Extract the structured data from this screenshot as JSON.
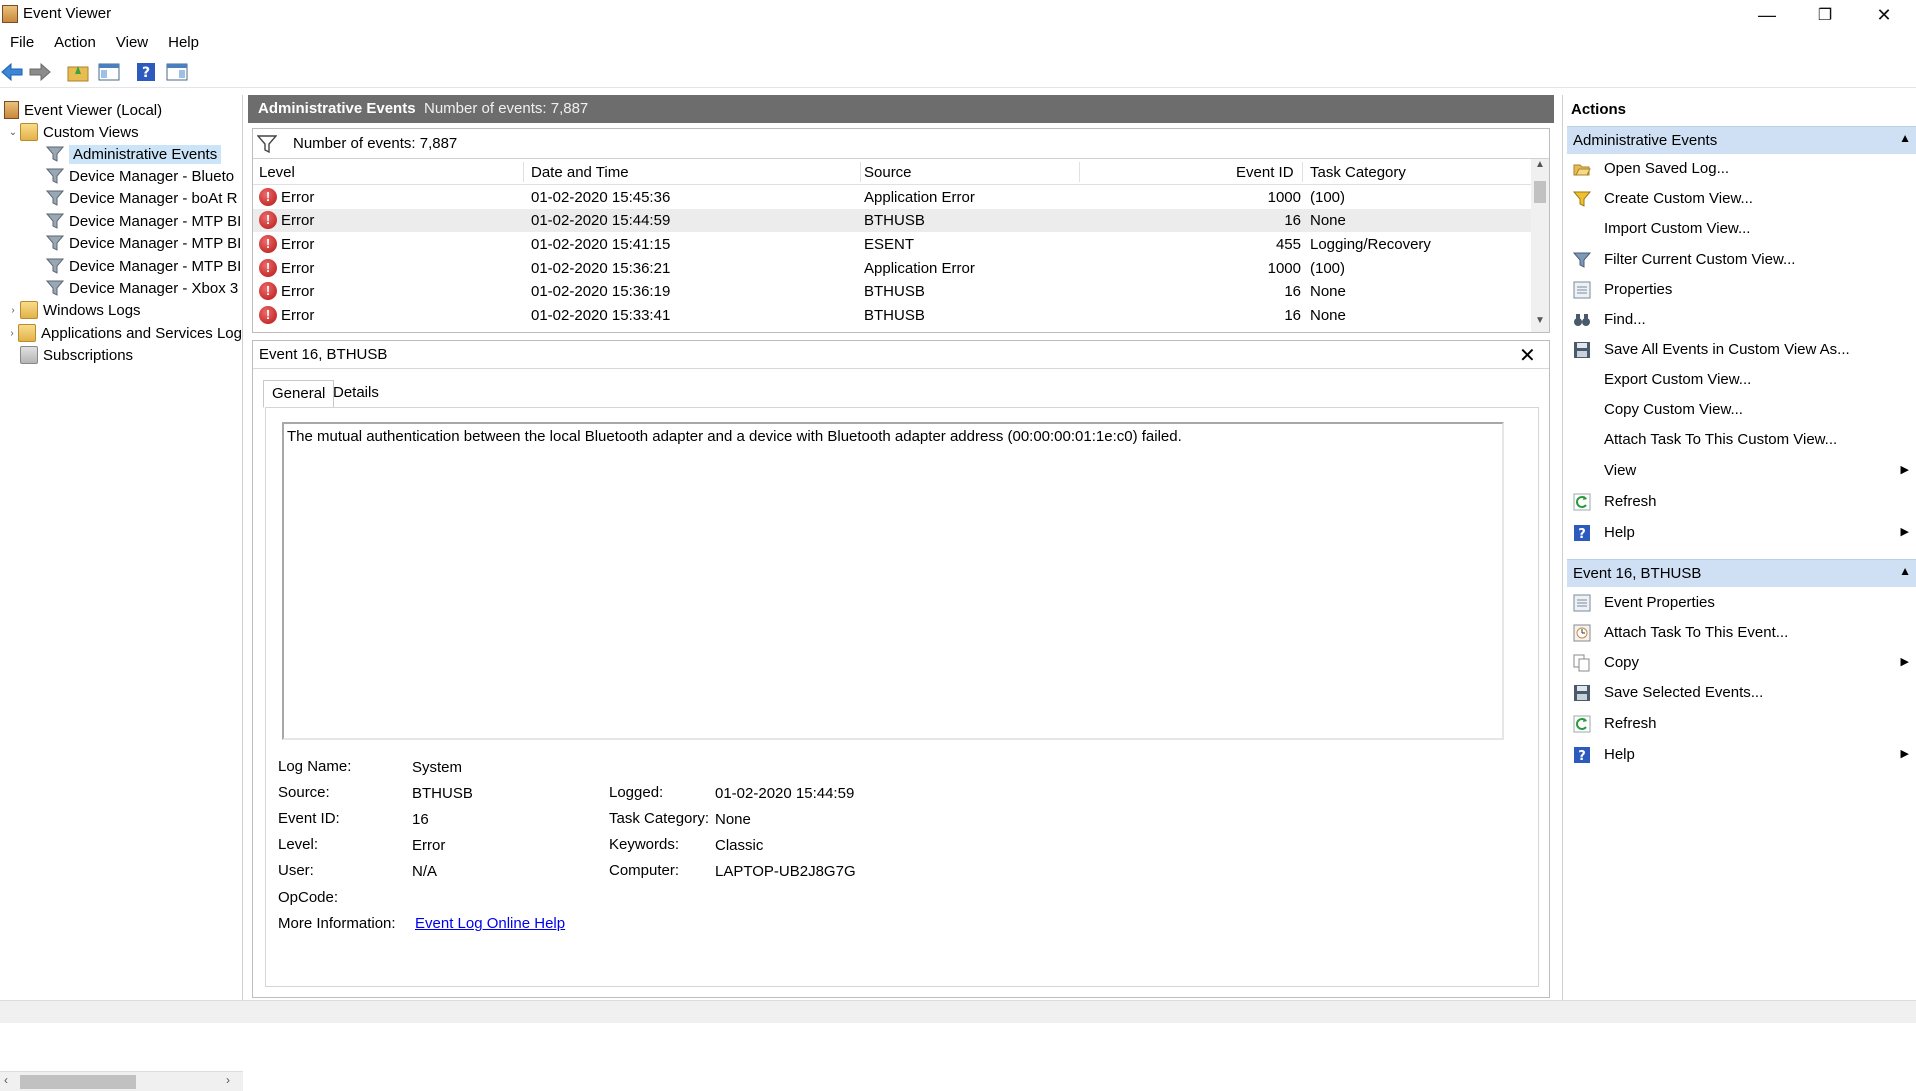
{
  "window": {
    "title": "Event Viewer",
    "minimize": "—",
    "maximize": "❐",
    "close": "✕"
  },
  "menu": [
    "File",
    "Action",
    "View",
    "Help"
  ],
  "tree": {
    "root": "Event Viewer (Local)",
    "custom_views": "Custom Views",
    "items": [
      "Administrative Events",
      "Device Manager - Blueto",
      "Device Manager - boAt R",
      "Device Manager - MTP BI",
      "Device Manager - MTP BI",
      "Device Manager - MTP BI",
      "Device Manager - Xbox 3"
    ],
    "windows_logs": "Windows Logs",
    "apps_logs": "Applications and Services Log",
    "subscriptions": "Subscriptions"
  },
  "middle": {
    "title": "Administrative Events",
    "count_label": "Number of events: 7,887",
    "filter_count": "Number of events: 7,887",
    "columns": [
      "Level",
      "Date and Time",
      "Source",
      "Event ID",
      "Task Category"
    ],
    "rows": [
      {
        "level": "Error",
        "date": "01-02-2020 15:45:36",
        "source": "Application Error",
        "id": "1000",
        "task": "(100)"
      },
      {
        "level": "Error",
        "date": "01-02-2020 15:44:59",
        "source": "BTHUSB",
        "id": "16",
        "task": "None"
      },
      {
        "level": "Error",
        "date": "01-02-2020 15:41:15",
        "source": "ESENT",
        "id": "455",
        "task": "Logging/Recovery"
      },
      {
        "level": "Error",
        "date": "01-02-2020 15:36:21",
        "source": "Application Error",
        "id": "1000",
        "task": "(100)"
      },
      {
        "level": "Error",
        "date": "01-02-2020 15:36:19",
        "source": "BTHUSB",
        "id": "16",
        "task": "None"
      },
      {
        "level": "Error",
        "date": "01-02-2020 15:33:41",
        "source": "BTHUSB",
        "id": "16",
        "task": "None"
      }
    ]
  },
  "detail": {
    "title": "Event 16, BTHUSB",
    "close": "✕",
    "tabs": [
      "General",
      "Details"
    ],
    "description": "The mutual authentication between the local Bluetooth adapter and a device with Bluetooth adapter address (00:00:00:01:1e:c0) failed.",
    "labels": {
      "log_name": "Log Name:",
      "source": "Source:",
      "event_id": "Event ID:",
      "level": "Level:",
      "user": "User:",
      "opcode": "OpCode:",
      "more_info": "More Information:",
      "logged": "Logged:",
      "task_category": "Task Category:",
      "keywords": "Keywords:",
      "computer": "Computer:"
    },
    "values": {
      "log_name": "System",
      "source": "BTHUSB",
      "event_id": "16",
      "level": "Error",
      "user": "N/A",
      "opcode": "",
      "more_info": "Event Log Online Help",
      "logged": "01-02-2020 15:44:59",
      "task_category": "None",
      "keywords": "Classic",
      "computer": "LAPTOP-UB2J8G7G"
    }
  },
  "actions": {
    "title": "Actions",
    "section1": "Administrative Events",
    "items1": [
      "Open Saved Log...",
      "Create Custom View...",
      "Import Custom View...",
      "Filter Current Custom View...",
      "Properties",
      "Find...",
      "Save All Events in Custom View As...",
      "Export Custom View...",
      "Copy Custom View...",
      "Attach Task To This Custom View...",
      "View",
      "Refresh",
      "Help"
    ],
    "section2": "Event 16, BTHUSB",
    "items2": [
      "Event Properties",
      "Attach Task To This Event...",
      "Copy",
      "Save Selected Events...",
      "Refresh",
      "Help"
    ]
  }
}
